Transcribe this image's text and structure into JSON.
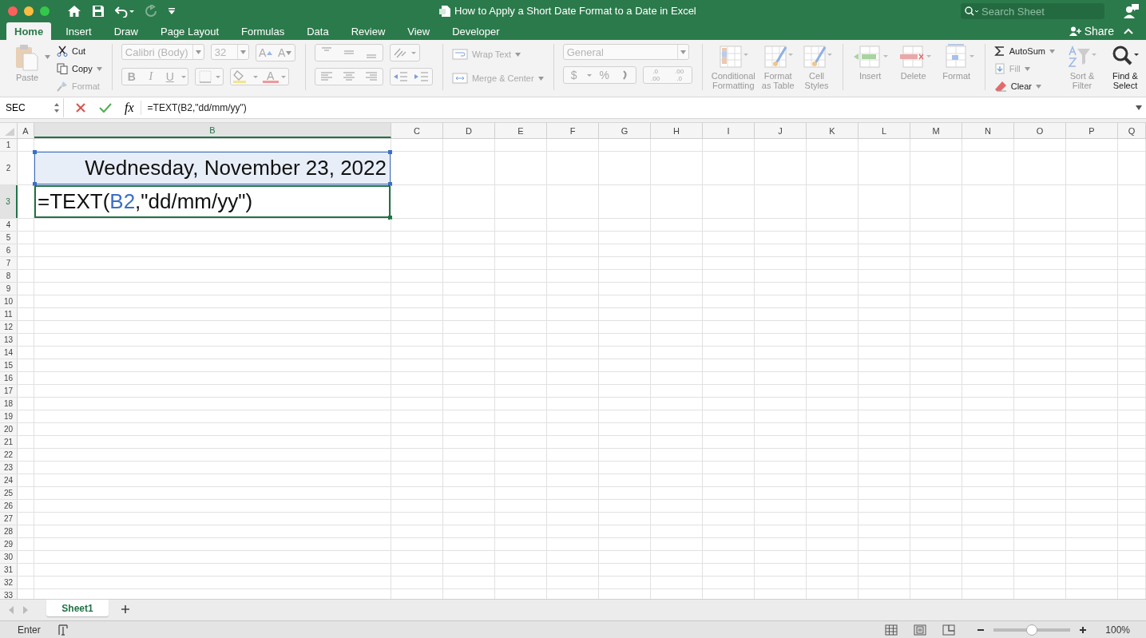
{
  "window": {
    "title": "How to Apply a Short Date Format to a Date in Excel",
    "search": {
      "placeholder": "Search Sheet"
    }
  },
  "quick_access": {
    "undo": {
      "disabled": false
    },
    "redo": {
      "disabled": true
    }
  },
  "tabs": [
    {
      "label": "Home",
      "selected": true
    },
    {
      "label": "Insert",
      "selected": false
    },
    {
      "label": "Draw",
      "selected": false
    },
    {
      "label": "Page Layout",
      "selected": false
    },
    {
      "label": "Formulas",
      "selected": false
    },
    {
      "label": "Data",
      "selected": false
    },
    {
      "label": "Review",
      "selected": false
    },
    {
      "label": "View",
      "selected": false
    },
    {
      "label": "Developer",
      "selected": false
    }
  ],
  "share": {
    "label": "Share"
  },
  "ribbon": {
    "paste": {
      "label": "Paste",
      "disabled": true
    },
    "clipboard": [
      {
        "label": "Cut",
        "disabled": false
      },
      {
        "label": "Copy",
        "disabled": false
      },
      {
        "label": "Format",
        "disabled": true
      }
    ],
    "font_name": {
      "value": "Calibri (Body)",
      "disabled": true
    },
    "font_size": {
      "value": "32",
      "disabled": true
    },
    "font_size_buttons": [
      {
        "label": "A",
        "disabled": true
      },
      {
        "label": "A",
        "disabled": true
      }
    ],
    "style_buttons": [
      {
        "label": "B",
        "disabled": true
      },
      {
        "label": "I",
        "disabled": true
      },
      {
        "label": "U",
        "disabled": true
      }
    ],
    "font_color": {
      "label": "A",
      "disabled": true
    },
    "wrap_text": {
      "label": "Wrap Text",
      "disabled": true
    },
    "merge_center": {
      "label": "Merge & Center",
      "disabled": true
    },
    "number_format": {
      "value": "General",
      "disabled": true
    },
    "number_buttons": [
      {
        "label": "$",
        "disabled": true
      },
      {
        "label": "%",
        "disabled": true
      }
    ],
    "decimal_buttons": [
      {
        "top": ".0",
        "bottom": ".00",
        "disabled": true
      },
      {
        "top": ".00",
        "bottom": ".0",
        "disabled": true
      }
    ],
    "styles": [
      {
        "label": "Conditional\nFormatting",
        "disabled": true
      },
      {
        "label": "Format\nas Table",
        "disabled": true
      },
      {
        "label": "Cell\nStyles",
        "disabled": true
      }
    ],
    "cells": [
      {
        "label": "Insert",
        "disabled": true
      },
      {
        "label": "Delete",
        "disabled": true
      },
      {
        "label": "Format",
        "disabled": true
      }
    ],
    "autosum": {
      "label": "AutoSum",
      "disabled": false
    },
    "fill": {
      "label": "Fill",
      "disabled": true
    },
    "clear": {
      "label": "Clear",
      "disabled": false
    },
    "sort_filter": {
      "label": "Sort &\nFilter",
      "disabled": true
    },
    "find_select": {
      "label": "Find &\nSelect",
      "disabled": false
    }
  },
  "formula_bar": {
    "name_box": "SEC",
    "fx": "fx",
    "formula": "=TEXT(B2,\"dd/mm/yy\")"
  },
  "columns": [
    {
      "label": "A",
      "selected": false
    },
    {
      "label": "B",
      "selected": true
    },
    {
      "label": "C",
      "selected": false
    },
    {
      "label": "D",
      "selected": false
    },
    {
      "label": "E",
      "selected": false
    },
    {
      "label": "F",
      "selected": false
    },
    {
      "label": "G",
      "selected": false
    },
    {
      "label": "H",
      "selected": false
    },
    {
      "label": "I",
      "selected": false
    },
    {
      "label": "J",
      "selected": false
    },
    {
      "label": "K",
      "selected": false
    },
    {
      "label": "L",
      "selected": false
    },
    {
      "label": "M",
      "selected": false
    },
    {
      "label": "N",
      "selected": false
    },
    {
      "label": "O",
      "selected": false
    },
    {
      "label": "P",
      "selected": false
    },
    {
      "label": "Q",
      "selected": false
    }
  ],
  "rows": [
    {
      "label": "1",
      "selected": false
    },
    {
      "label": "2",
      "selected": false,
      "cells": [
        {
          "kind": "empty"
        },
        {
          "kind": "reference",
          "text": "Wednesday, November 23, 2022"
        }
      ]
    },
    {
      "label": "3",
      "selected": true,
      "cells": [
        {
          "kind": "empty"
        },
        {
          "kind": "active",
          "parts": [
            {
              "kind": "plain",
              "text": "=TEXT("
            },
            {
              "kind": "reference",
              "text": "B2"
            },
            {
              "kind": "plain",
              "text": ",\"dd/mm/yy\")"
            }
          ]
        }
      ]
    },
    {
      "label": "4",
      "selected": false
    },
    {
      "label": "5",
      "selected": false
    },
    {
      "label": "6",
      "selected": false
    },
    {
      "label": "7",
      "selected": false
    },
    {
      "label": "8",
      "selected": false
    },
    {
      "label": "9",
      "selected": false
    },
    {
      "label": "10",
      "selected": false
    },
    {
      "label": "11",
      "selected": false
    },
    {
      "label": "12",
      "selected": false
    },
    {
      "label": "13",
      "selected": false
    },
    {
      "label": "14",
      "selected": false
    },
    {
      "label": "15",
      "selected": false
    },
    {
      "label": "16",
      "selected": false
    },
    {
      "label": "17",
      "selected": false
    },
    {
      "label": "18",
      "selected": false
    },
    {
      "label": "19",
      "selected": false
    },
    {
      "label": "20",
      "selected": false
    },
    {
      "label": "21",
      "selected": false
    },
    {
      "label": "22",
      "selected": false
    },
    {
      "label": "23",
      "selected": false
    },
    {
      "label": "24",
      "selected": false
    },
    {
      "label": "25",
      "selected": false
    },
    {
      "label": "26",
      "selected": false
    },
    {
      "label": "27",
      "selected": false
    },
    {
      "label": "28",
      "selected": false
    },
    {
      "label": "29",
      "selected": false
    },
    {
      "label": "30",
      "selected": false
    },
    {
      "label": "31",
      "selected": false
    },
    {
      "label": "32",
      "selected": false
    },
    {
      "label": "33",
      "selected": false
    }
  ],
  "sheets": [
    {
      "label": "Sheet1",
      "selected": true
    }
  ],
  "status_bar": {
    "mode": "Enter",
    "zoom": {
      "level": 0.5,
      "reading": "100%"
    }
  }
}
